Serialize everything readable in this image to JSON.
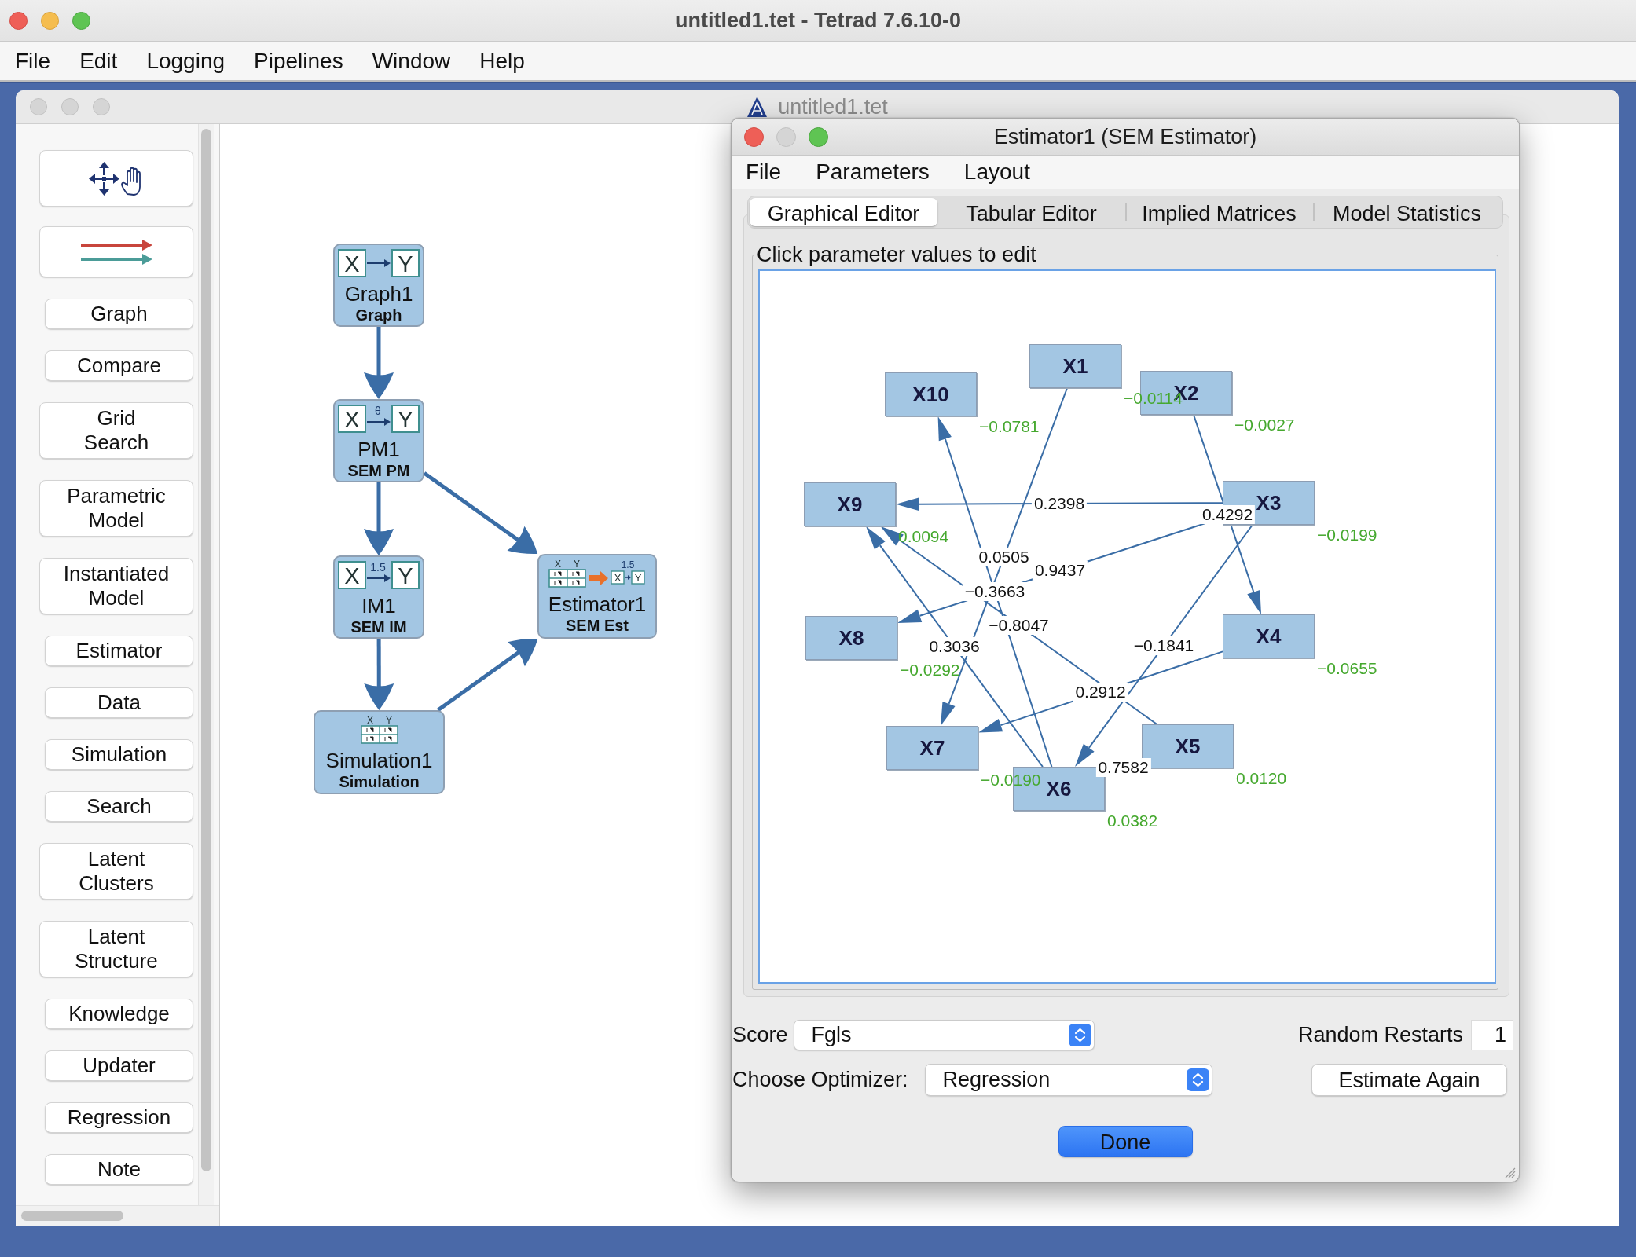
{
  "window": {
    "title": "untitled1.tet - Tetrad 7.6.10-0",
    "active": true
  },
  "menu_bar": [
    "File",
    "Edit",
    "Logging",
    "Pipelines",
    "Window",
    "Help"
  ],
  "session_window": {
    "title": "untitled1.tet",
    "active": false
  },
  "toolbox": {
    "items": [
      {
        "kind": "move"
      },
      {
        "kind": "flow"
      },
      {
        "kind": "text",
        "label": "Graph"
      },
      {
        "kind": "text",
        "label": "Compare"
      },
      {
        "kind": "text",
        "label": "Grid\nSearch"
      },
      {
        "kind": "text",
        "label": "Parametric\nModel"
      },
      {
        "kind": "text",
        "label": "Instantiated\nModel"
      },
      {
        "kind": "text",
        "label": "Estimator"
      },
      {
        "kind": "text",
        "label": "Data"
      },
      {
        "kind": "text",
        "label": "Simulation"
      },
      {
        "kind": "text",
        "label": "Search"
      },
      {
        "kind": "text",
        "label": "Latent\nClusters"
      },
      {
        "kind": "text",
        "label": "Latent\nStructure"
      },
      {
        "kind": "text",
        "label": "Knowledge"
      },
      {
        "kind": "text",
        "label": "Updater"
      },
      {
        "kind": "text",
        "label": "Regression"
      },
      {
        "kind": "text",
        "label": "Note"
      }
    ]
  },
  "session": {
    "nodes": [
      {
        "name": "Graph1",
        "type": "Graph",
        "icon": {
          "kind": "pair",
          "cause": "X",
          "effect": "Y"
        }
      },
      {
        "name": "PM1",
        "type": "SEM PM",
        "icon": {
          "kind": "pair",
          "cause": "X",
          "effect": "Y",
          "arrow_label": "θ"
        }
      },
      {
        "name": "IM1",
        "type": "SEM IM",
        "icon": {
          "kind": "pair",
          "cause": "X",
          "effect": "Y",
          "arrow_label": "1.5"
        }
      },
      {
        "name": "Estimator1",
        "type": "SEM Est",
        "icon": {
          "kind": "estimate",
          "columns": [
            "X",
            "Y"
          ],
          "cause": "X",
          "effect": "Y",
          "arrow_label": "1.5"
        }
      },
      {
        "name": "Simulation1",
        "type": "Simulation",
        "icon": {
          "kind": "table",
          "columns": [
            "X",
            "Y"
          ]
        }
      }
    ]
  },
  "estimator_window": {
    "title": "Estimator1 (SEM Estimator)",
    "active": true,
    "menu_bar": [
      "File",
      "Parameters",
      "Layout"
    ],
    "tabs": [
      {
        "label": "Graphical Editor",
        "selected": true
      },
      {
        "label": "Tabular Editor",
        "selected": false
      },
      {
        "label": "Implied Matrices",
        "selected": false
      },
      {
        "label": "Model Statistics",
        "selected": false
      }
    ],
    "panel_title": "Click parameter values to edit",
    "graph": {
      "nodes": [
        {
          "name": "X1",
          "error_variance": "−0.0114"
        },
        {
          "name": "X10",
          "error_variance": "−0.0781"
        },
        {
          "name": "X2",
          "error_variance": "−0.0027"
        },
        {
          "name": "X9",
          "error_variance": "0.0094"
        },
        {
          "name": "X3",
          "error_variance": "−0.0199"
        },
        {
          "name": "X8",
          "error_variance": "−0.0292"
        },
        {
          "name": "X4",
          "error_variance": "−0.0655"
        },
        {
          "name": "X7",
          "error_variance": "−0.0190"
        },
        {
          "name": "X5",
          "error_variance": "0.0120"
        },
        {
          "name": "X6",
          "error_variance": "0.0382"
        }
      ],
      "edges": [
        {
          "coefficient": "0.2398"
        },
        {
          "coefficient": "0.4292"
        },
        {
          "coefficient": "0.0505"
        },
        {
          "coefficient": "0.9437"
        },
        {
          "coefficient": "−0.3663"
        },
        {
          "coefficient": "−0.8047"
        },
        {
          "coefficient": "0.3036"
        },
        {
          "coefficient": "−0.1841"
        },
        {
          "coefficient": "0.2912"
        },
        {
          "coefficient": "0.7582"
        }
      ]
    },
    "score": {
      "label": "Score",
      "value": "Fgls"
    },
    "random_restarts": {
      "label": "Random Restarts",
      "value": "1"
    },
    "optimizer": {
      "label": "Choose Optimizer:",
      "value": "Regression"
    },
    "buttons": [
      {
        "label": "Estimate Again",
        "default": false
      },
      {
        "label": "Done",
        "default": true
      }
    ]
  }
}
